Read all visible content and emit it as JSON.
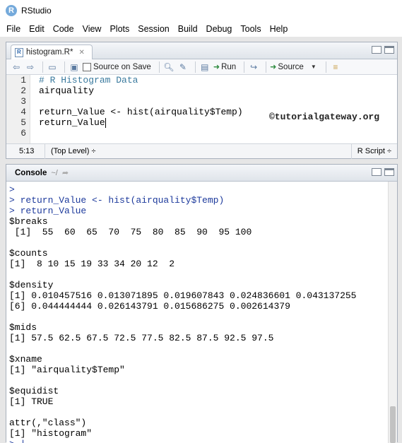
{
  "window": {
    "title": "RStudio",
    "logo_letter": "R"
  },
  "menu": [
    "File",
    "Edit",
    "Code",
    "View",
    "Plots",
    "Session",
    "Build",
    "Debug",
    "Tools",
    "Help"
  ],
  "editor": {
    "tab_label": "histogram.R*",
    "toolbar": {
      "source_on_save": "Source on Save",
      "run": "Run",
      "source": "Source"
    },
    "line_numbers": [
      "1",
      "2",
      "3",
      "4",
      "5",
      "6"
    ],
    "code_lines": [
      "# R Histogram Data",
      "airquality",
      "",
      "return_Value <- hist(airquality$Temp)",
      "return_Value",
      ""
    ],
    "watermark": "©tutorialgateway.org",
    "status": {
      "position": "5:13",
      "scope": "(Top Level) ÷",
      "language": "R Script ÷"
    }
  },
  "console": {
    "title": "Console",
    "path": "~/",
    "lines": [
      {
        "text": ">",
        "kind": "input"
      },
      {
        "text": "> return_Value <- hist(airquality$Temp)",
        "kind": "input"
      },
      {
        "text": "> return_Value",
        "kind": "input"
      },
      {
        "text": "$breaks",
        "kind": "output"
      },
      {
        "text": " [1]  55  60  65  70  75  80  85  90  95 100",
        "kind": "output"
      },
      {
        "text": "",
        "kind": "output"
      },
      {
        "text": "$counts",
        "kind": "output"
      },
      {
        "text": "[1]  8 10 15 19 33 34 20 12  2",
        "kind": "output"
      },
      {
        "text": "",
        "kind": "output"
      },
      {
        "text": "$density",
        "kind": "output"
      },
      {
        "text": "[1] 0.010457516 0.013071895 0.019607843 0.024836601 0.043137255",
        "kind": "output"
      },
      {
        "text": "[6] 0.044444444 0.026143791 0.015686275 0.002614379",
        "kind": "output"
      },
      {
        "text": "",
        "kind": "output"
      },
      {
        "text": "$mids",
        "kind": "output"
      },
      {
        "text": "[1] 57.5 62.5 67.5 72.5 77.5 82.5 87.5 92.5 97.5",
        "kind": "output"
      },
      {
        "text": "",
        "kind": "output"
      },
      {
        "text": "$xname",
        "kind": "output"
      },
      {
        "text": "[1] \"airquality$Temp\"",
        "kind": "output"
      },
      {
        "text": "",
        "kind": "output"
      },
      {
        "text": "$equidist",
        "kind": "output"
      },
      {
        "text": "[1] TRUE",
        "kind": "output"
      },
      {
        "text": "",
        "kind": "output"
      },
      {
        "text": "attr(,\"class\")",
        "kind": "output"
      },
      {
        "text": "[1] \"histogram\"",
        "kind": "output"
      },
      {
        "text": "> |",
        "kind": "input"
      }
    ]
  }
}
